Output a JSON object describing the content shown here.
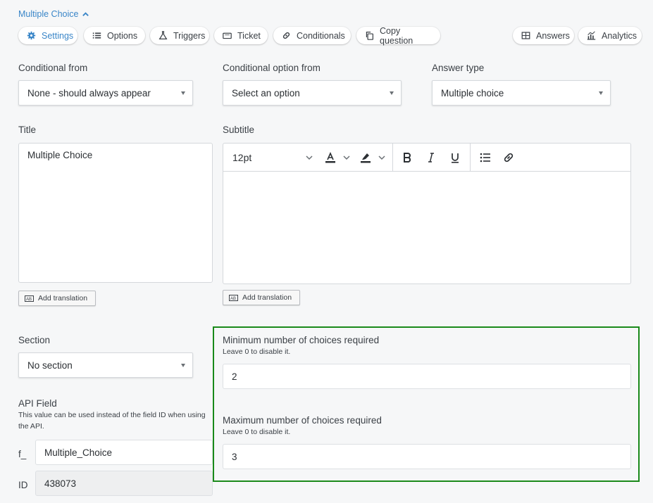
{
  "question": {
    "header_label": "Multiple Choice"
  },
  "tabs": [
    {
      "label": "Settings",
      "icon": "gear-icon"
    },
    {
      "label": "Options",
      "icon": "list-icon"
    },
    {
      "label": "Triggers",
      "icon": "flask-icon"
    },
    {
      "label": "Ticket",
      "icon": "ticket-icon"
    },
    {
      "label": "Conditionals",
      "icon": "link-icon"
    },
    {
      "label": "Copy question",
      "icon": "copy-icon"
    },
    {
      "label": "Answers",
      "icon": "table-icon"
    },
    {
      "label": "Analytics",
      "icon": "chart-icon"
    }
  ],
  "conditional_from": {
    "label": "Conditional from",
    "value": "None - should always appear"
  },
  "conditional_option_from": {
    "label": "Conditional option from",
    "value": "Select an option"
  },
  "answer_type": {
    "label": "Answer type",
    "value": "Multiple choice"
  },
  "title_field": {
    "label": "Title",
    "value": "Multiple Choice",
    "add_translation": "Add translation"
  },
  "subtitle_field": {
    "label": "Subtitle",
    "font_size": "12pt",
    "add_translation": "Add translation"
  },
  "section": {
    "label": "Section",
    "value": "No section"
  },
  "api_field": {
    "label": "API Field",
    "hint": "This value can be used instead of the field ID when using the API.",
    "prefix": "f_",
    "value": "Multiple_Choice",
    "id_label": "ID",
    "id_value": "438073"
  },
  "min_choices": {
    "label": "Minimum number of choices required",
    "hint": "Leave 0 to disable it.",
    "value": "2"
  },
  "max_choices": {
    "label": "Maximum number of choices required",
    "hint": "Leave 0 to disable it.",
    "value": "3"
  },
  "colors": {
    "accent": "#3a86c8",
    "highlight_border": "#1a8a1a"
  }
}
